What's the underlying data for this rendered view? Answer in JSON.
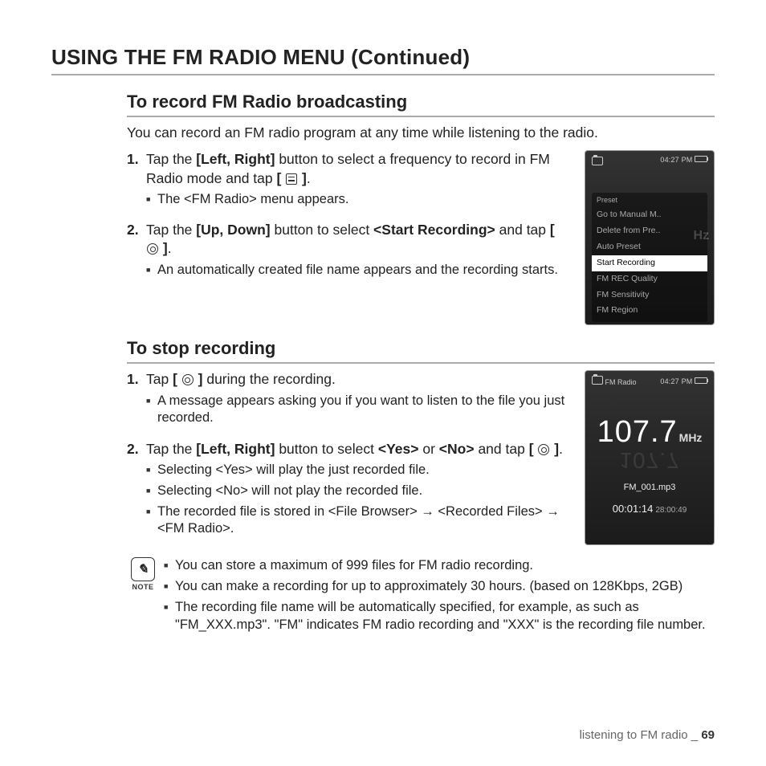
{
  "page": {
    "main_title": "USING THE FM RADIO MENU (Continued)",
    "footer_section": "listening to FM radio _",
    "footer_page": "69"
  },
  "s1": {
    "title": "To record FM Radio broadcasting",
    "intro": "You can record an FM radio program at any time while listening to the radio.",
    "step1_a": "Tap the ",
    "step1_b": "[Left, Right]",
    "step1_c": " button to select a frequency to record in FM Radio mode and tap ",
    "step1_d": ".",
    "step1_sub1": "The <FM Radio> menu appears.",
    "step2_a": "Tap the ",
    "step2_b": "[Up, Down]",
    "step2_c": " button to select ",
    "step2_d": "<Start Recording>",
    "step2_e": " and tap ",
    "step2_f": ".",
    "step2_sub1": "An automatically created file name appears and the recording starts."
  },
  "dev1": {
    "time": "04:27 PM",
    "menu_label": "Preset",
    "items": [
      "Go to Manual M..",
      "Delete from Pre..",
      "Auto Preset",
      "Start Recording",
      "FM REC Quality",
      "FM Sensitivity",
      "FM Region"
    ],
    "bg_unit": "Hz"
  },
  "s2": {
    "title": "To stop recording",
    "step1_a": "Tap ",
    "step1_b": " during the recording.",
    "step1_sub1": "A message appears asking you if you want to listen to the file you just recorded.",
    "step2_a": "Tap the ",
    "step2_b": "[Left, Right]",
    "step2_c": " button to select ",
    "step2_d": "<Yes>",
    "step2_e": " or ",
    "step2_f": "<No>",
    "step2_g": " and tap ",
    "step2_h": ".",
    "step2_sub1": "Selecting <Yes> will play the just recorded file.",
    "step2_sub2": "Selecting <No> will not play the recorded file.",
    "step2_sub3": "The recorded file is stored in <File Browser> → <Recorded Files> → <FM Radio>."
  },
  "dev2": {
    "time": "04:27 PM",
    "title": "FM Radio",
    "freq": "107.7",
    "unit": "MHz",
    "file": "FM_001.mp3",
    "elapsed": "00:01:14",
    "remain": "28:00:49"
  },
  "notes": {
    "label": "NOTE",
    "n1": "You can store a maximum of 999 files for FM radio recording.",
    "n2": "You can make a recording for up to approximately 30 hours. (based on 128Kbps, 2GB)",
    "n3": "The recording file name will be automatically specified, for example, as such as \"FM_XXX.mp3\". \"FM\" indicates FM radio recording and \"XXX\" is the recording file number."
  }
}
